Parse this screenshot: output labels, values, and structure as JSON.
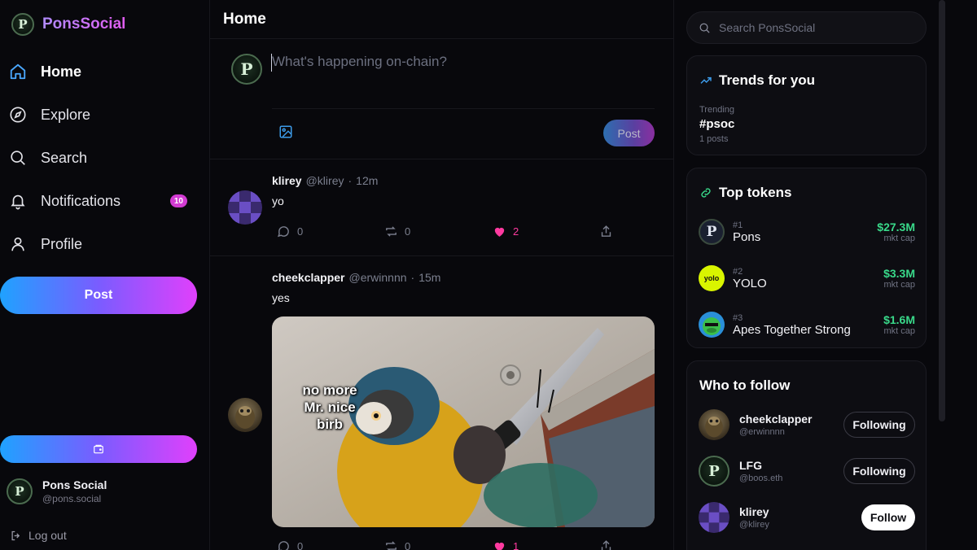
{
  "brand": {
    "name": "PonsSocial",
    "logo_letter": "P"
  },
  "nav": [
    {
      "label": "Home",
      "icon": "home-icon",
      "active": true
    },
    {
      "label": "Explore",
      "icon": "compass-icon"
    },
    {
      "label": "Search",
      "icon": "search-icon"
    },
    {
      "label": "Notifications",
      "icon": "bell-icon",
      "badge": "10"
    },
    {
      "label": "Profile",
      "icon": "user-icon"
    }
  ],
  "sidebar": {
    "post_label": "Post",
    "account": {
      "name": "Pons Social",
      "handle": "@pons.social"
    },
    "logout_label": "Log out"
  },
  "main": {
    "title": "Home",
    "composer": {
      "placeholder": "What's happening on-chain?",
      "post_label": "Post"
    },
    "posts": [
      {
        "name": "klirey",
        "handle": "@klirey",
        "time": "12m",
        "text": "yo",
        "replies": "0",
        "reposts": "0",
        "likes": "2"
      },
      {
        "name": "cheekclapper",
        "handle": "@erwinnnn",
        "time": "15m",
        "text": "yes",
        "image_caption": "no more Mr. nice birb",
        "replies": "0",
        "reposts": "0",
        "likes": "1"
      }
    ]
  },
  "right": {
    "search_placeholder": "Search PonsSocial",
    "trends": {
      "title": "Trends for you",
      "items": [
        {
          "label": "Trending",
          "tag": "#psoc",
          "count": "1 posts"
        }
      ]
    },
    "tokens": {
      "title": "Top tokens",
      "items": [
        {
          "rank": "#1",
          "name": "Pons",
          "cap": "$27.3M",
          "cap_label": "mkt cap"
        },
        {
          "rank": "#2",
          "name": "YOLO",
          "cap": "$3.3M",
          "cap_label": "mkt cap",
          "logo_text": "yolo"
        },
        {
          "rank": "#3",
          "name": "Apes Together Strong",
          "cap": "$1.6M",
          "cap_label": "mkt cap"
        }
      ]
    },
    "who_to_follow": {
      "title": "Who to follow",
      "items": [
        {
          "name": "cheekclapper",
          "handle": "@erwinnnn",
          "button": "Following"
        },
        {
          "name": "LFG",
          "handle": "@boos.eth",
          "button": "Following"
        },
        {
          "name": "klirey",
          "handle": "@klirey",
          "button": "Follow"
        }
      ]
    }
  },
  "colors": {
    "accent_gradient_start": "#1fa2ff",
    "accent_gradient_end": "#e040fb",
    "market_cap_green": "#39d98a",
    "like_pink": "#ff3aa0",
    "badge_magenta": "#d23bd2"
  }
}
